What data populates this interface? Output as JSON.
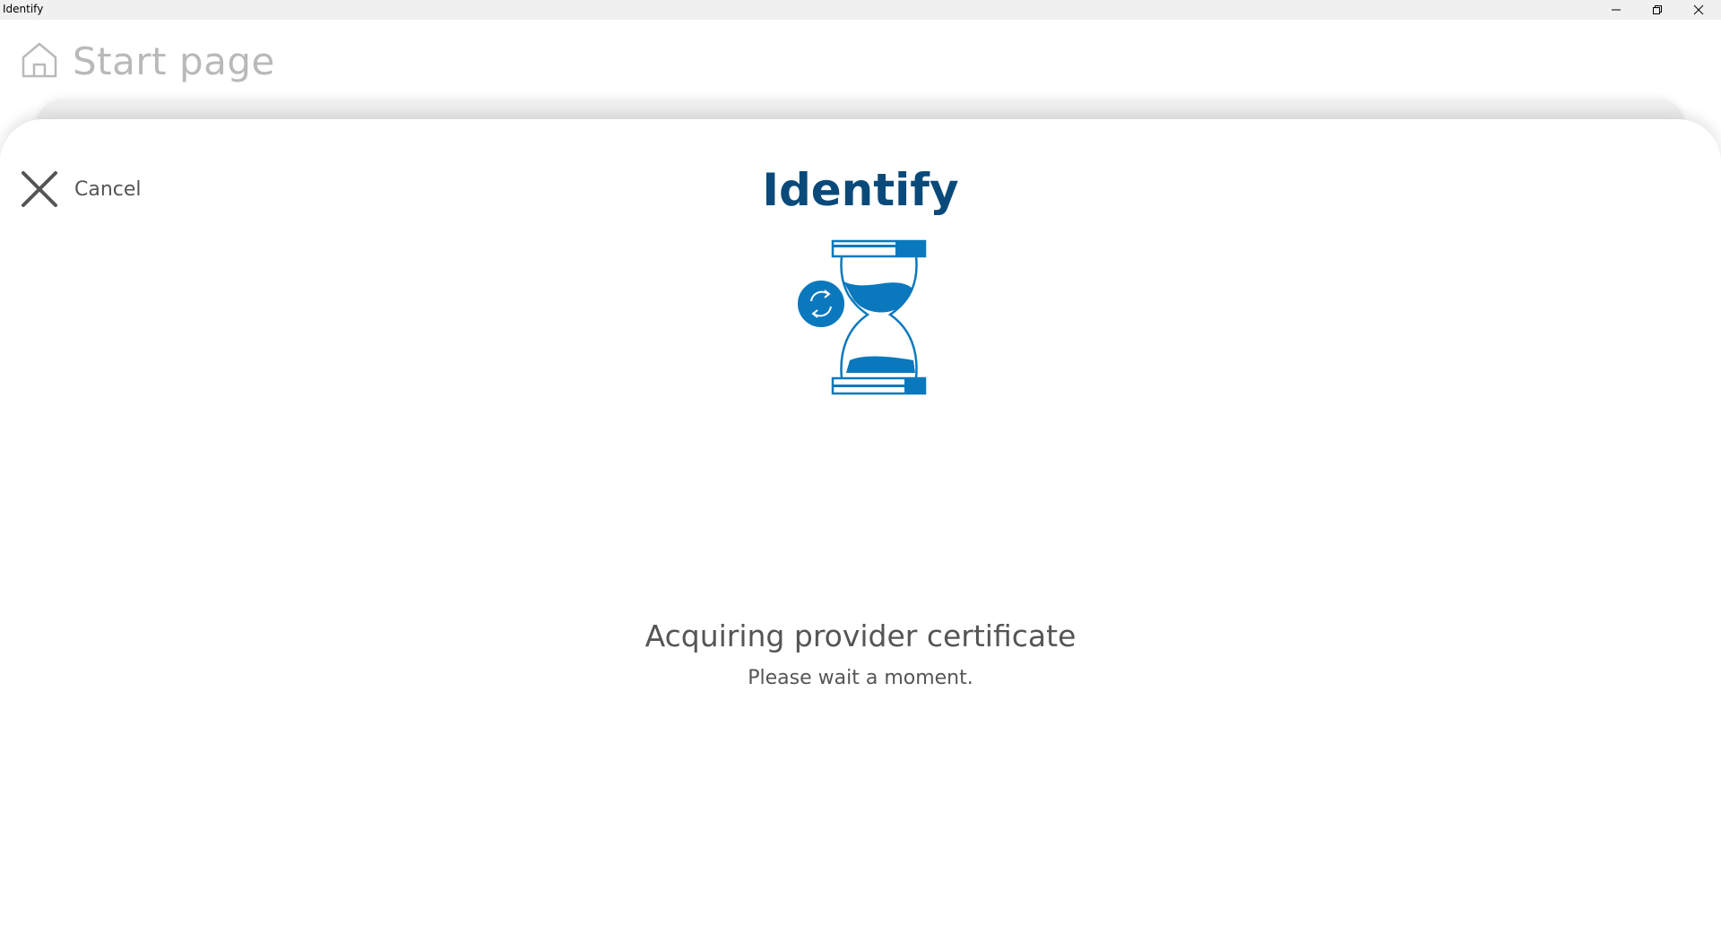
{
  "window": {
    "title": "Identify",
    "controls": [
      "minimize-icon",
      "restore-icon",
      "close-icon"
    ]
  },
  "header": {
    "icon": "home-icon",
    "title": "Start page"
  },
  "dialog": {
    "cancel_label": "Cancel",
    "cancel_icon": "close-x-icon",
    "title": "Identify",
    "illustration": "hourglass-refresh-icon",
    "status_title": "Acquiring provider certificate",
    "status_subtitle": "Please wait a moment."
  },
  "colors": {
    "title": "#0a4a7a",
    "accent": "#0a78bd",
    "text": "#555555",
    "header_text": "#b9b9b9"
  }
}
